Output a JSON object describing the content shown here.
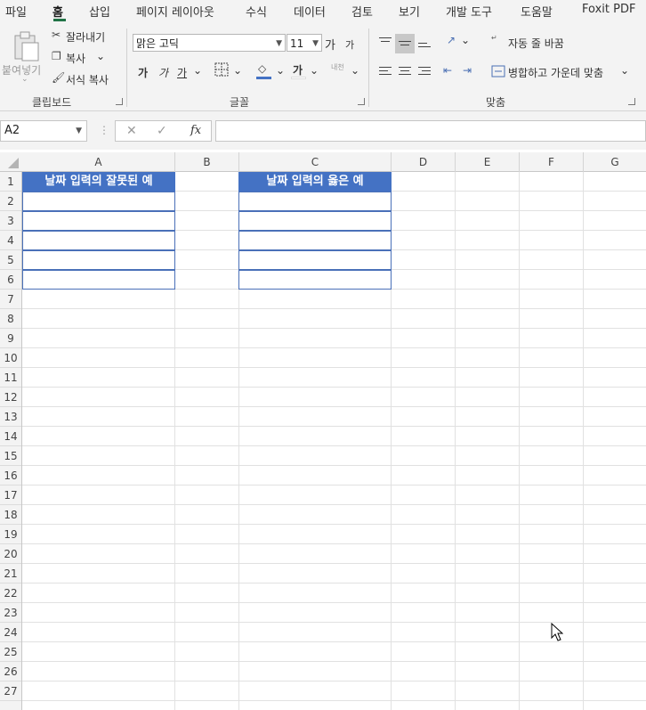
{
  "menu": {
    "items": [
      "파일",
      "홈",
      "삽입",
      "페이지 레이아웃",
      "수식",
      "데이터",
      "검토",
      "보기",
      "개발 도구",
      "도움말",
      "Foxit PDF"
    ],
    "active": "홈"
  },
  "ribbon": {
    "clipboard": {
      "paste_label": "붙여넣기",
      "cut_label": "잘라내기",
      "copy_label": "복사",
      "format_painter_label": "서식 복사",
      "group_label": "클립보드"
    },
    "font": {
      "font_name": "맑은 고딕",
      "font_size": "11",
      "grow_label": "가",
      "shrink_label": "가",
      "bold_label": "가",
      "italic_label": "가",
      "underline_label": "가",
      "font_color_label": "가",
      "phonetic_label": "내천",
      "group_label": "글꼴"
    },
    "alignment": {
      "wrap_text_label": "자동 줄 바꿈",
      "merge_center_label": "병합하고 가운데 맞춤",
      "group_label": "맞춤"
    },
    "accent_color": "#217346",
    "font_color_bar": "#4472c4"
  },
  "formula_bar": {
    "name_box": "A2",
    "fx_label": "fx",
    "formula": ""
  },
  "sheet": {
    "columns": [
      "A",
      "B",
      "C",
      "D",
      "E",
      "F",
      "G"
    ],
    "rows": [
      "1",
      "2",
      "3",
      "4",
      "5",
      "6",
      "7",
      "8",
      "9",
      "10",
      "11",
      "12",
      "13",
      "14",
      "15",
      "16",
      "17",
      "18",
      "19",
      "20",
      "21",
      "22",
      "23",
      "24",
      "25",
      "26",
      "27"
    ],
    "header_color": "#4472c4",
    "table1_header": "날짜 입력의 잘못된 예",
    "table2_header": "날짜 입력의 옳은 예"
  }
}
